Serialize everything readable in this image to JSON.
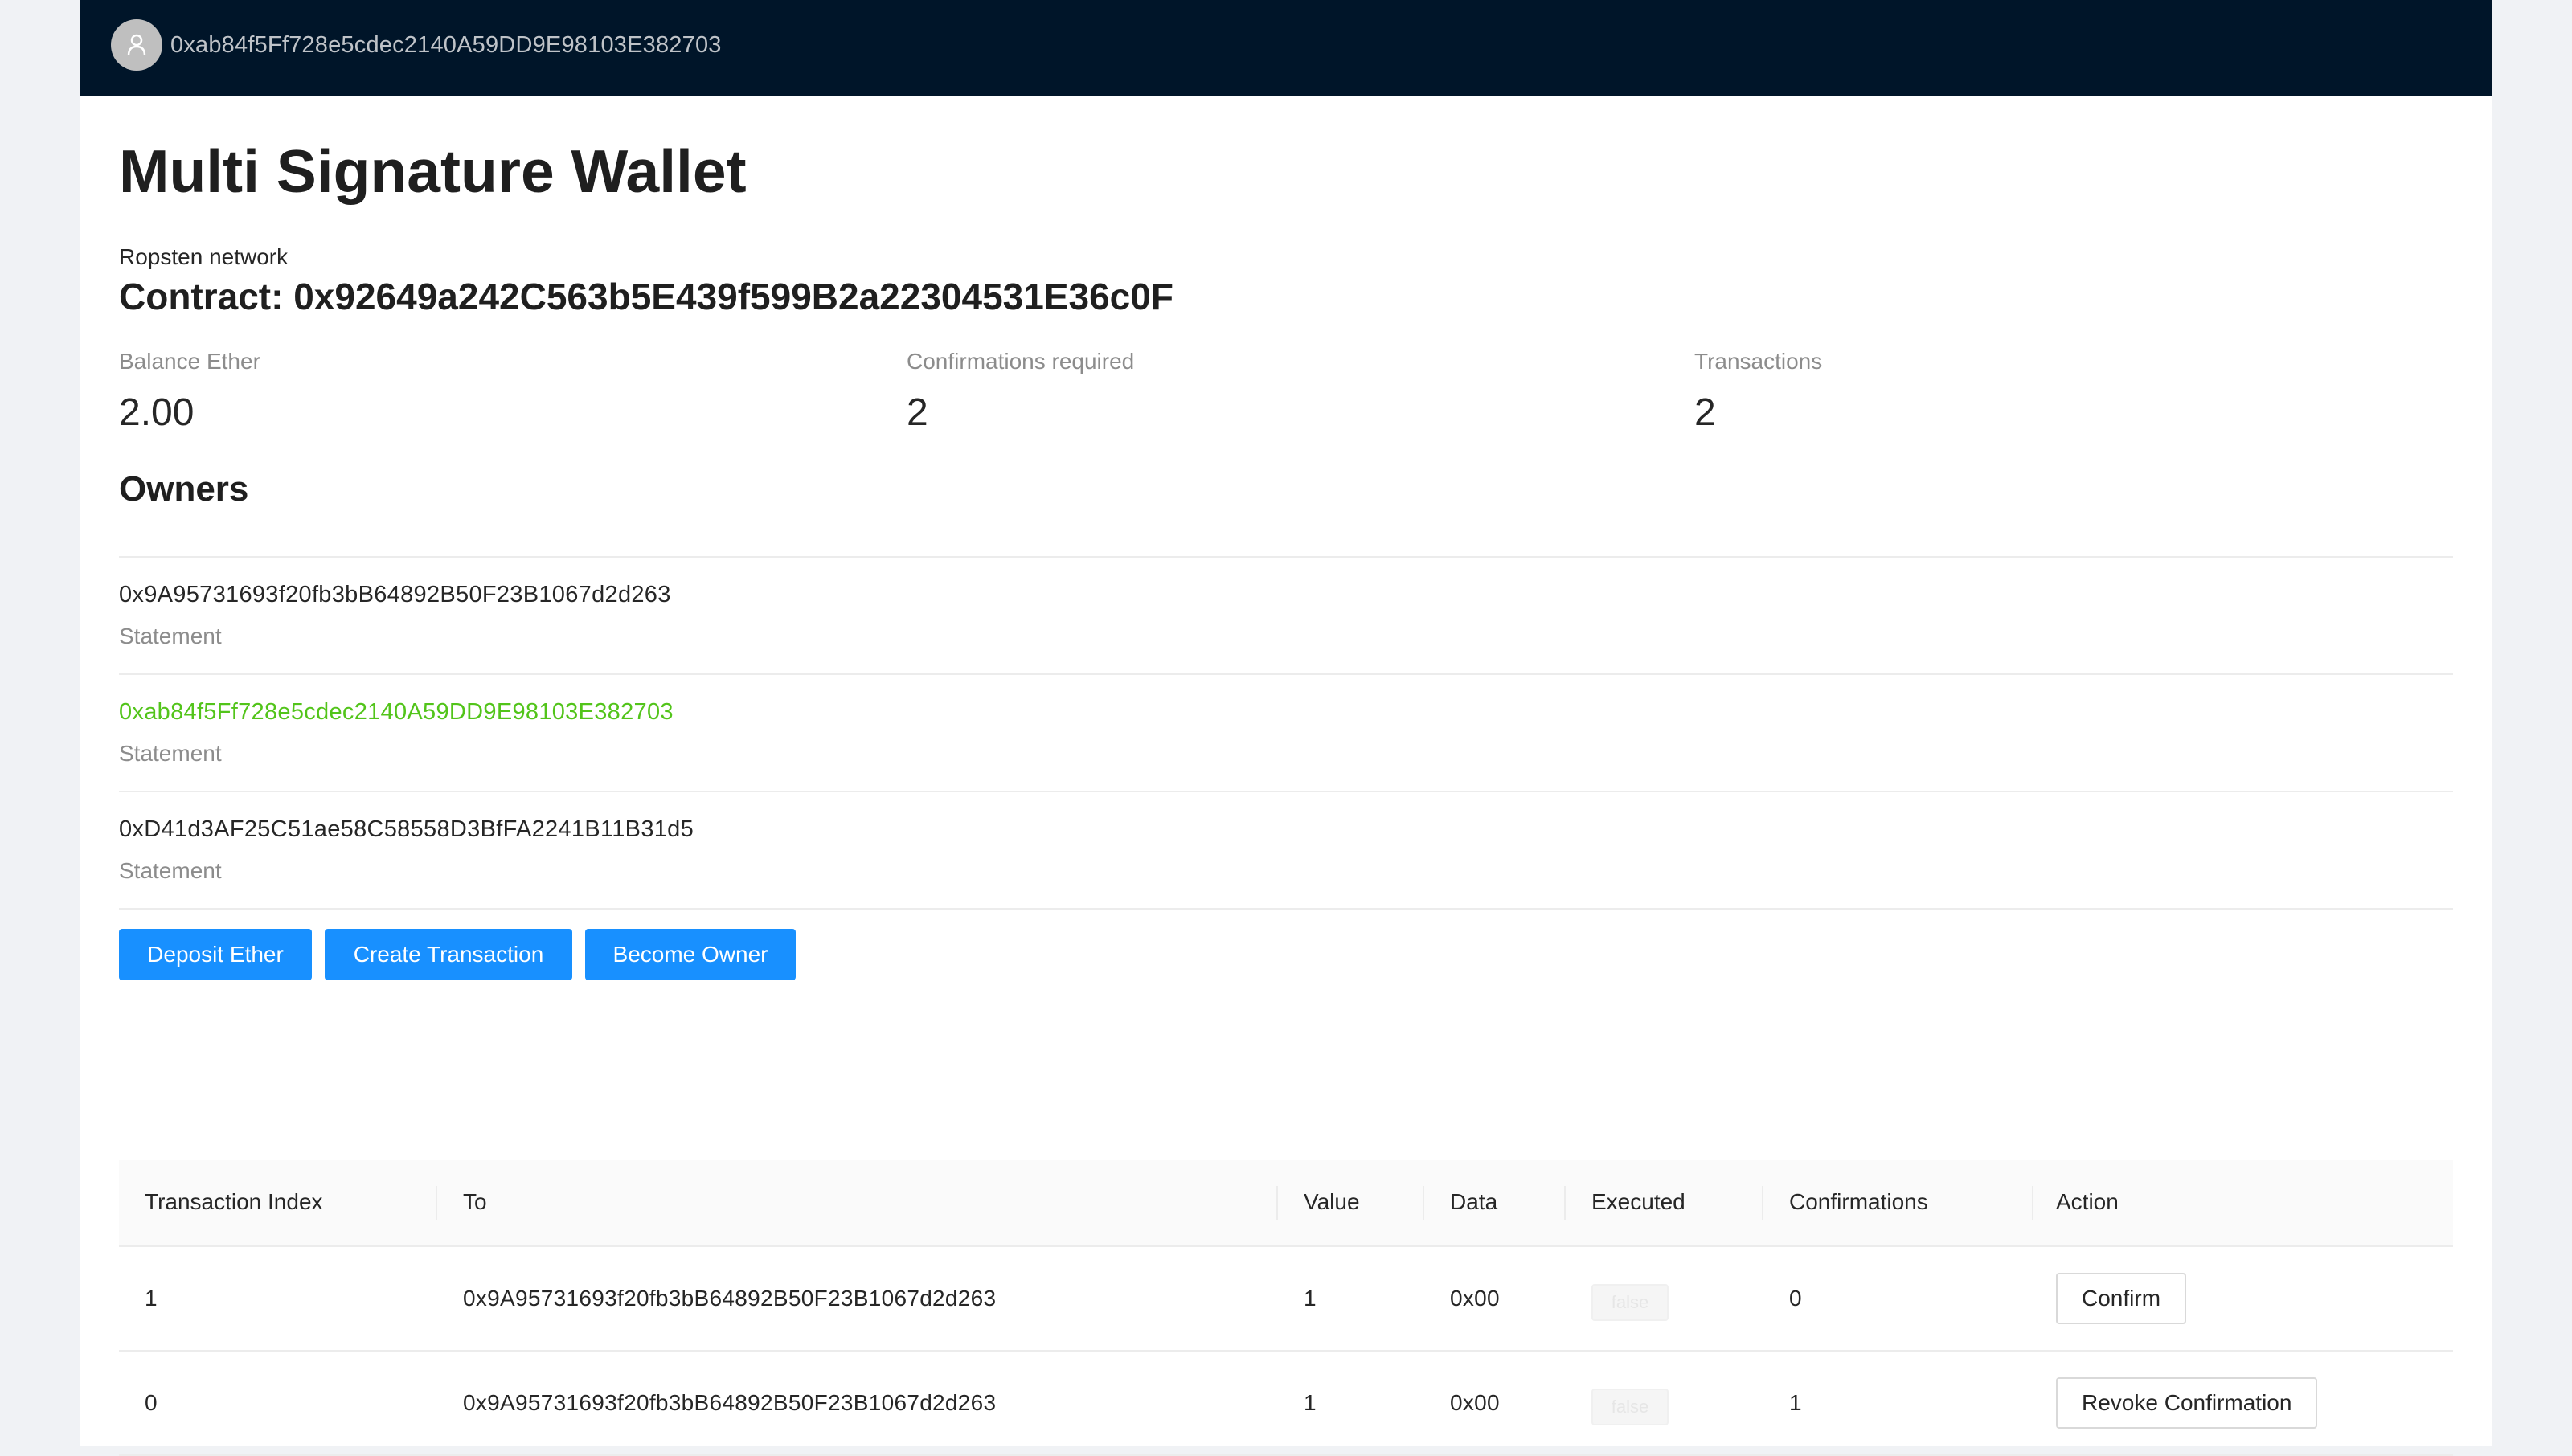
{
  "header": {
    "account_address": "0xab84f5Ff728e5cdec2140A59DD9E98103E382703"
  },
  "page": {
    "title": "Multi Signature Wallet",
    "network": "Ropsten network",
    "contract_label": "Contract: 0x92649a242C563b5E439f599B2a22304531E36c0F"
  },
  "stats": [
    {
      "label": "Balance Ether",
      "value": "2.00"
    },
    {
      "label": "Confirmations required",
      "value": "2"
    },
    {
      "label": "Transactions",
      "value": "2"
    }
  ],
  "owners": {
    "title": "Owners",
    "items": [
      {
        "address": "0x9A95731693f20fb3bB64892B50F23B1067d2d263",
        "description": "Statement",
        "is_current": false
      },
      {
        "address": "0xab84f5Ff728e5cdec2140A59DD9E98103E382703",
        "description": "Statement",
        "is_current": true
      },
      {
        "address": "0xD41d3AF25C51ae58C58558D3BfFA2241B11B31d5",
        "description": "Statement",
        "is_current": false
      }
    ]
  },
  "actions": {
    "deposit_label": "Deposit Ether",
    "create_label": "Create Transaction",
    "become_owner_label": "Become Owner"
  },
  "table": {
    "columns": [
      "Transaction Index",
      "To",
      "Value",
      "Data",
      "Executed",
      "Confirmations",
      "Action"
    ],
    "rows": [
      {
        "index": "1",
        "to": "0x9A95731693f20fb3bB64892B50F23B1067d2d263",
        "value": "1",
        "data": "0x00",
        "executed": "false",
        "confirmations": "0",
        "action": "Confirm"
      },
      {
        "index": "0",
        "to": "0x9A95731693f20fb3bB64892B50F23B1067d2d263",
        "value": "1",
        "data": "0x00",
        "executed": "false",
        "confirmations": "1",
        "action": "Revoke Confirmation"
      }
    ]
  },
  "colors": {
    "header_bg": "#001529",
    "primary": "#1890ff",
    "current_owner": "#52c41a"
  },
  "icons": {
    "avatar": "user-icon"
  }
}
